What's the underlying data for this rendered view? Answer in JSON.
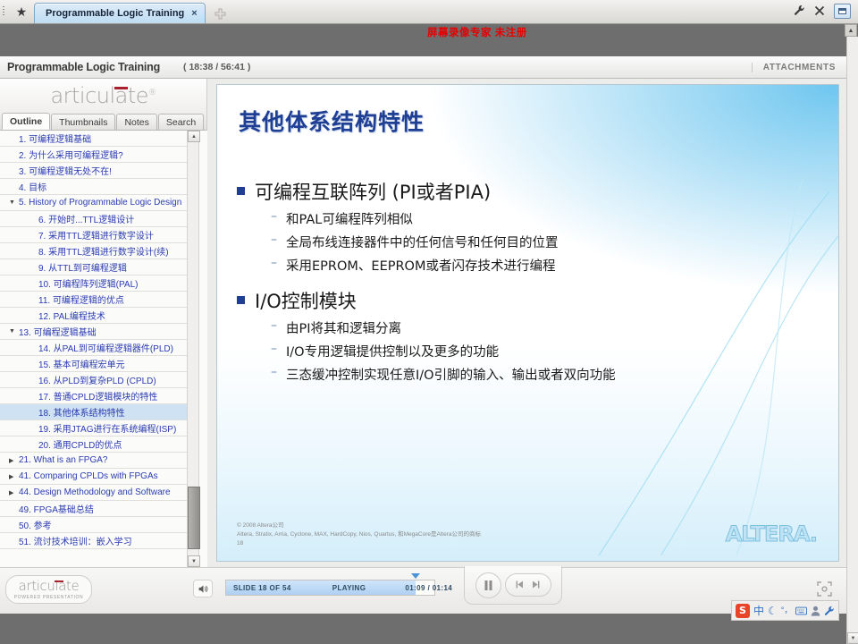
{
  "browser": {
    "star_icon": "star-icon",
    "tab_title": "Programmable Logic Training",
    "tab_close": "×",
    "new_tab_icon": "+",
    "wrench_icon": "🔧",
    "close_icon": "×",
    "restore_icon": "restore-window-icon"
  },
  "watermark": {
    "text": "屏幕录像专家  未注册"
  },
  "player_header": {
    "title": "Programmable Logic Training",
    "time": "( 18:38 / 56:41 )",
    "attachments_label": "ATTACHMENTS"
  },
  "sidebar": {
    "logo_text": "articulate",
    "logo_reg": "®",
    "tabs": [
      {
        "label": "Outline",
        "active": true
      },
      {
        "label": "Thumbnails",
        "active": false
      },
      {
        "label": "Notes",
        "active": false
      },
      {
        "label": "Search",
        "active": false
      }
    ],
    "items": [
      {
        "num": "1.",
        "label": "可编程逻辑基础",
        "level": 1,
        "marker": "",
        "selected": false
      },
      {
        "num": "2.",
        "label": "为什么采用可编程逻辑?",
        "level": 1,
        "marker": "",
        "selected": false
      },
      {
        "num": "3.",
        "label": "可编程逻辑无处不在!",
        "level": 1,
        "marker": "",
        "selected": false
      },
      {
        "num": "4.",
        "label": "目标",
        "level": 1,
        "marker": "",
        "selected": false
      },
      {
        "num": "5.",
        "label": "History of Programmable Logic Design",
        "level": 1,
        "marker": "down",
        "selected": false
      },
      {
        "num": "6.",
        "label": "开始时...TTL逻辑设计",
        "level": 2,
        "marker": "",
        "selected": false
      },
      {
        "num": "7.",
        "label": "采用TTL逻辑进行数字设计",
        "level": 2,
        "marker": "",
        "selected": false
      },
      {
        "num": "8.",
        "label": "采用TTL逻辑进行数字设计(续)",
        "level": 2,
        "marker": "",
        "selected": false
      },
      {
        "num": "9.",
        "label": "从TTL到可编程逻辑",
        "level": 2,
        "marker": "",
        "selected": false
      },
      {
        "num": "10.",
        "label": "可编程阵列逻辑(PAL)",
        "level": 2,
        "marker": "",
        "selected": false
      },
      {
        "num": "11.",
        "label": "可编程逻辑的优点",
        "level": 2,
        "marker": "",
        "selected": false
      },
      {
        "num": "12.",
        "label": "PAL编程技术",
        "level": 2,
        "marker": "",
        "selected": false
      },
      {
        "num": "13.",
        "label": "可编程逻辑基础",
        "level": 1,
        "marker": "down",
        "selected": false
      },
      {
        "num": "14.",
        "label": "从PAL到可编程逻辑器件(PLD)",
        "level": 2,
        "marker": "",
        "selected": false
      },
      {
        "num": "15.",
        "label": "基本可编程宏单元",
        "level": 2,
        "marker": "",
        "selected": false
      },
      {
        "num": "16.",
        "label": "从PLD到复杂PLD (CPLD)",
        "level": 2,
        "marker": "",
        "selected": false
      },
      {
        "num": "17.",
        "label": "普通CPLD逻辑模块的特性",
        "level": 2,
        "marker": "",
        "selected": false
      },
      {
        "num": "18.",
        "label": "其他体系结构特性",
        "level": 2,
        "marker": "",
        "selected": true
      },
      {
        "num": "19.",
        "label": "采用JTAG进行在系统编程(ISP)",
        "level": 2,
        "marker": "",
        "selected": false
      },
      {
        "num": "20.",
        "label": "通用CPLD的优点",
        "level": 2,
        "marker": "",
        "selected": false
      },
      {
        "num": "21.",
        "label": "What is an FPGA?",
        "level": 1,
        "marker": "right",
        "selected": false
      },
      {
        "num": "41.",
        "label": "Comparing CPLDs with FPGAs",
        "level": 1,
        "marker": "right",
        "selected": false
      },
      {
        "num": "44.",
        "label": "Design Methodology and Software",
        "level": 1,
        "marker": "right",
        "selected": false
      },
      {
        "num": "49.",
        "label": "FPGA基础总结",
        "level": 1,
        "marker": "",
        "selected": false
      },
      {
        "num": "50.",
        "label": "参考",
        "level": 1,
        "marker": "",
        "selected": false
      },
      {
        "num": "51.",
        "label": "流讨技术培训：嵌入学习",
        "level": 1,
        "marker": "",
        "selected": false
      }
    ]
  },
  "slide": {
    "title": "其他体系结构特性",
    "blocks": [
      {
        "heading": "可编程互联阵列 (PI或者PIA)",
        "subs": [
          "和PAL可编程阵列相似",
          "全局布线连接器件中的任何信号和任何目的位置",
          "采用EPROM、EEPROM或者闪存技术进行编程"
        ]
      },
      {
        "heading": "I/O控制模块",
        "subs": [
          "由PI将其和逻辑分离",
          "I/O专用逻辑提供控制以及更多的功能",
          "三态缓冲控制实现任意I/O引脚的输入、输出或者双向功能"
        ]
      }
    ],
    "footer_line1": "© 2008 Altera公司",
    "footer_line2": "Altera, Stratix, Arria, Cyclone, MAX, HardCopy, Nios, Quartus, 和MegaCore是Altera公司的商标",
    "footer_line3": "18",
    "brand_logo": "ALTERA."
  },
  "controls": {
    "articulate_word": "articulate",
    "articulate_sub": "POWERED PRESENTATION",
    "volume_icon": "speaker-icon",
    "seek": {
      "slide_label": "SLIDE 18 OF 54",
      "state_label": "PLAYING",
      "time_label": "01:09 / 01:14",
      "progress_percent": 91
    },
    "pause_icon": "❙❙",
    "prev_icon": "◀❙",
    "next_icon": "❙▶",
    "fullscreen_icon": "fullscreen-icon"
  },
  "ime": {
    "logo": "S",
    "mode": "中",
    "moon_icon": "☾",
    "punct_icon": "°，",
    "keyboard_icon": "⌨",
    "user_icon": "👤",
    "tools_icon": "🔧"
  },
  "colors": {
    "accent_blue": "#1e3f94",
    "outline_text": "#2a3bb0",
    "selection": "#cfe2f3",
    "watermark_red": "#e60000",
    "altera_logo": "#bfe3f4"
  }
}
